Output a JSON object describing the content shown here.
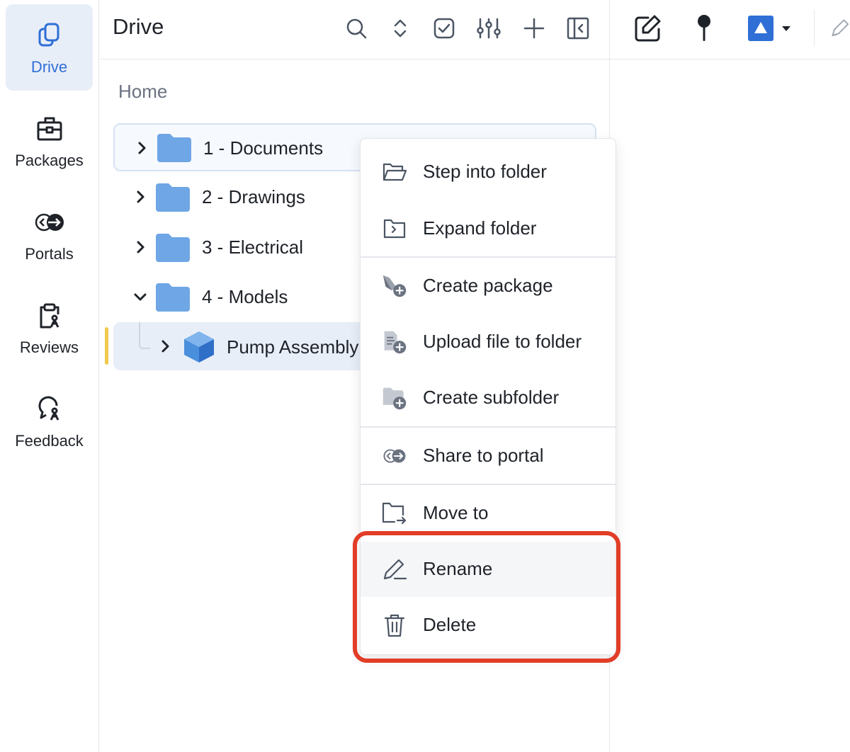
{
  "sidebar": {
    "items": [
      {
        "label": "Drive",
        "icon": "drive-icon",
        "active": true
      },
      {
        "label": "Packages",
        "icon": "packages-icon"
      },
      {
        "label": "Portals",
        "icon": "portals-icon"
      },
      {
        "label": "Reviews",
        "icon": "reviews-icon"
      },
      {
        "label": "Feedback",
        "icon": "feedback-icon"
      }
    ]
  },
  "header": {
    "title": "Drive",
    "actions": [
      "search-icon",
      "sort-icon",
      "select-icon",
      "filter-icon",
      "add-icon",
      "collapse-panel-icon"
    ]
  },
  "right_toolbar": {
    "actions": [
      "edit-icon",
      "pin-icon",
      "color-picker",
      "pen-icon"
    ],
    "accent_color": "#2f6fd6"
  },
  "breadcrumb": "Home",
  "tree": {
    "rows": [
      {
        "label": "1 - Documents",
        "expanded": false,
        "type": "folder"
      },
      {
        "label": "2 - Drawings",
        "expanded": false,
        "type": "folder"
      },
      {
        "label": "3 - Electrical",
        "expanded": false,
        "type": "folder"
      },
      {
        "label": "4 - Models",
        "expanded": true,
        "type": "folder"
      },
      {
        "label": "Pump Assembly",
        "expanded": false,
        "type": "model"
      }
    ]
  },
  "context_menu": {
    "items": [
      {
        "label": "Step into folder",
        "icon": "open-folder-icon"
      },
      {
        "label": "Expand folder",
        "icon": "expand-folder-icon"
      },
      {
        "label": "Create package",
        "icon": "create-package-icon"
      },
      {
        "label": "Upload file to folder",
        "icon": "upload-file-icon"
      },
      {
        "label": "Create subfolder",
        "icon": "create-subfolder-icon"
      },
      {
        "label": "Share to portal",
        "icon": "share-portal-icon"
      },
      {
        "label": "Move to",
        "icon": "move-to-icon"
      },
      {
        "label": "Rename",
        "icon": "rename-icon"
      },
      {
        "label": "Delete",
        "icon": "trash-icon"
      }
    ]
  },
  "colors": {
    "folder": "#6ea6e6",
    "accent": "#2f6fd6",
    "highlight_ring": "#e23d27",
    "selection_bar": "#f0c94d"
  }
}
